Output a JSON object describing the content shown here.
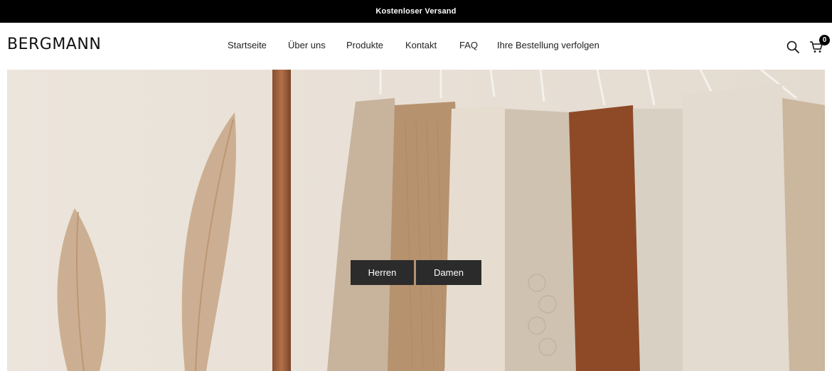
{
  "announcement": {
    "text": "Kostenloser Versand"
  },
  "header": {
    "logo": "BERGMANN",
    "nav": [
      {
        "label": "Startseite"
      },
      {
        "label": "Über uns"
      },
      {
        "label": "Produkte"
      },
      {
        "label": "Kontakt"
      },
      {
        "label": "FAQ"
      },
      {
        "label": "Ihre Bestellung verfolgen"
      }
    ],
    "icons": {
      "search": "search-icon",
      "cart": "cart-icon"
    },
    "cart_count": "0"
  },
  "hero": {
    "image": "clothing-rack-with-sweaters-and-pampas-grass",
    "buttons": [
      {
        "label": "Herren"
      },
      {
        "label": "Damen"
      }
    ]
  },
  "colors": {
    "announcement_bg": "#000000",
    "button_bg": "#2b2b2b",
    "hero_wall": "#e8e0d6"
  }
}
